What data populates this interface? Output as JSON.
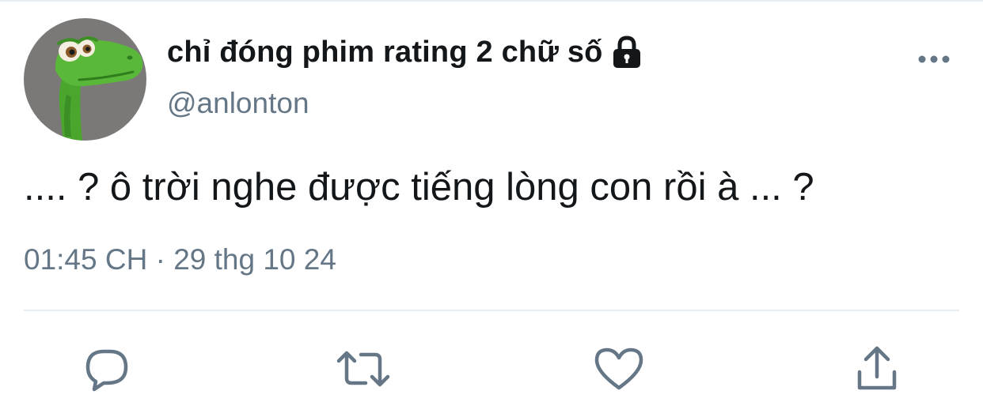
{
  "tweet": {
    "author": {
      "display_name": "chỉ đóng phim rating 2 chữ số",
      "handle": "@anlonton",
      "protected_icon": "lock-icon",
      "avatar_icon": "green-dinosaur-avatar"
    },
    "text": ".... ? ô trời nghe được tiếng lòng con rồi à ... ?",
    "timestamp": {
      "time": "01:45 CH",
      "separator": "·",
      "date": "29 thg 10 24"
    },
    "more_icon": "more-options-icon"
  },
  "actions": [
    {
      "name": "reply",
      "icon": "reply-icon"
    },
    {
      "name": "retweet",
      "icon": "retweet-icon"
    },
    {
      "name": "like",
      "icon": "heart-icon"
    },
    {
      "name": "share",
      "icon": "share-icon"
    }
  ],
  "colors": {
    "text_primary": "#14171a",
    "text_secondary": "#657786",
    "divider": "#e6ecf0",
    "background": "#ffffff"
  }
}
